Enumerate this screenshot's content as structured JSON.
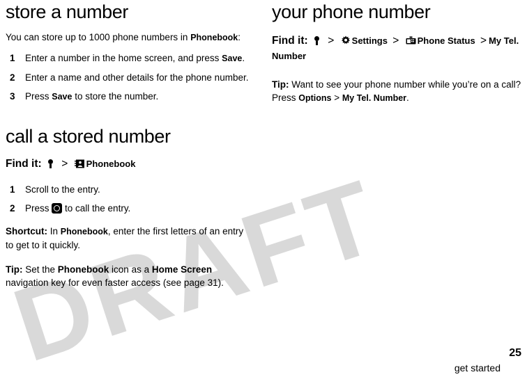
{
  "document": {
    "watermark": "DRAFT",
    "folio": {
      "page_number": "25",
      "section": "get started"
    }
  },
  "left_column": {
    "heading_store": "store a number",
    "intro": {
      "before": "You can store up to 1000 phone numbers in ",
      "bold": "Phonebook",
      "after": ":"
    },
    "steps": [
      {
        "num": "1",
        "before": "Enter a number in the home screen, and press ",
        "bold": "Save",
        "after": "."
      },
      {
        "num": "2",
        "before": "Enter a name and other details for the phone number.",
        "bold": "",
        "after": ""
      },
      {
        "num": "3",
        "before": "Press ",
        "bold": "Save",
        "after": " to store the number."
      }
    ],
    "heading_call": "call a stored number",
    "find_it": {
      "label": "Find it:",
      "sep": ">",
      "item_phonebook": "Phonebook"
    },
    "call_steps": [
      {
        "num": "1",
        "text": "Scroll to the entry."
      },
      {
        "num": "2",
        "before": "Press ",
        "after": " to call the entry."
      }
    ],
    "shortcut": {
      "label": "Shortcut:",
      "t1": " In ",
      "b1": "Phonebook",
      "t2": ", enter the first letters of an entry to get to it quickly."
    },
    "tip": {
      "label": "Tip:",
      "t1": " Set the ",
      "b1": "Phonebook",
      "t2": " icon as a ",
      "b2": "Home Screen",
      "t3": " navigation key for even faster access (see page 31)."
    }
  },
  "right_column": {
    "heading": "your phone number",
    "find_it": {
      "label": "Find it:",
      "sep1": ">",
      "settings": "Settings",
      "sep2": ">",
      "phone_status": "Phone Status",
      "sep3": ">",
      "my_tel_number": "My Tel. Number"
    },
    "tip": {
      "label": "Tip:",
      "t1": " Want to see your phone number while you’re on a call? Press ",
      "b1": "Options",
      "t2": " > ",
      "b2": "My Tel. Number",
      "t3": "."
    }
  }
}
